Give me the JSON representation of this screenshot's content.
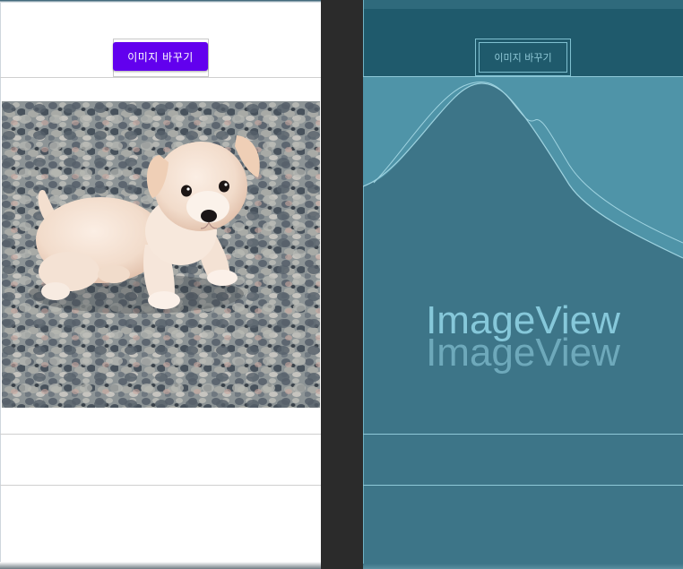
{
  "design": {
    "change_image_button": "이미지 바꾸기",
    "image_subject": "puppy-on-gravel-photo"
  },
  "blueprint": {
    "change_image_button": "이미지 바꾸기",
    "imageview_label": "ImageView",
    "imageview_label_echo": "ImageView"
  },
  "colors": {
    "primary": "#6200ee",
    "blueprint_bg": "#3d7588",
    "blueprint_top": "#1f5a6c",
    "blueprint_line": "#8fc9d8",
    "editor_gutter": "#2b2b2b"
  }
}
